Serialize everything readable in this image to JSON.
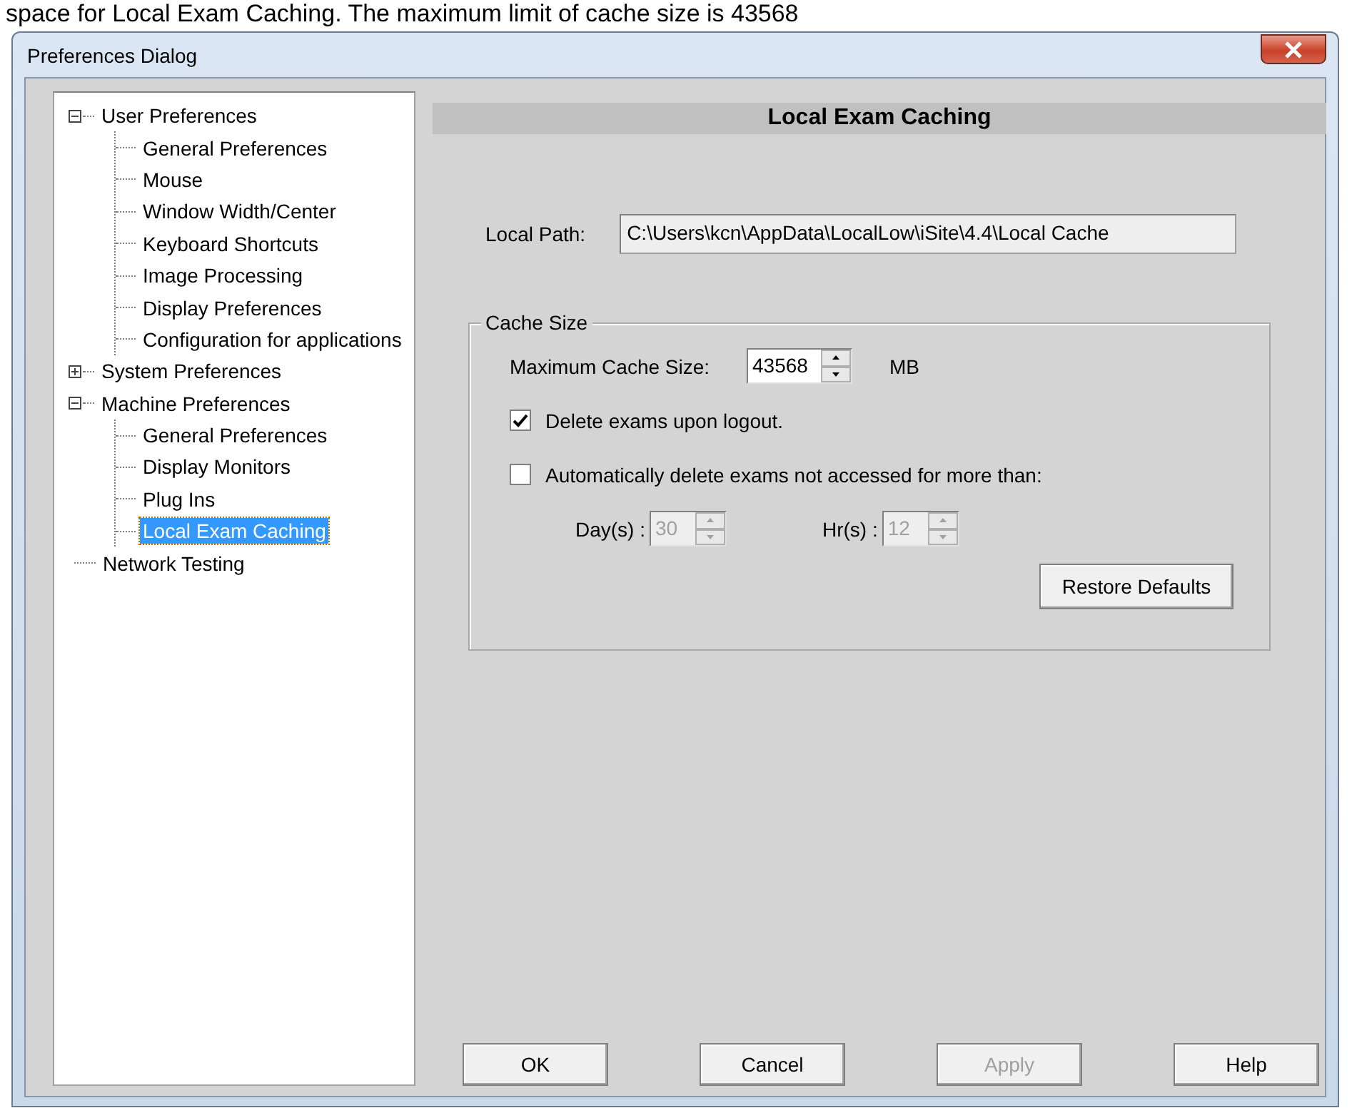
{
  "caption": "space for Local Exam Caching. The maximum limit of cache size is 43568",
  "window": {
    "title": "Preferences Dialog"
  },
  "tree": [
    {
      "label": "User Preferences",
      "expanded": true,
      "selected": false,
      "children": [
        {
          "label": "General Preferences",
          "selected": false
        },
        {
          "label": "Mouse",
          "selected": false
        },
        {
          "label": "Window Width/Center",
          "selected": false
        },
        {
          "label": "Keyboard Shortcuts",
          "selected": false
        },
        {
          "label": "Image Processing",
          "selected": false
        },
        {
          "label": "Display Preferences",
          "selected": false
        },
        {
          "label": "Configuration for applications",
          "selected": false
        }
      ]
    },
    {
      "label": "System Preferences",
      "expanded": false,
      "selected": false
    },
    {
      "label": "Machine Preferences",
      "expanded": true,
      "selected": false,
      "children": [
        {
          "label": "General Preferences",
          "selected": false
        },
        {
          "label": "Display Monitors",
          "selected": false
        },
        {
          "label": "Plug Ins",
          "selected": false
        },
        {
          "label": "Local Exam Caching",
          "selected": true
        }
      ]
    },
    {
      "label": "Network Testing",
      "selected": false
    }
  ],
  "panel": {
    "heading": "Local Exam Caching",
    "local_path": {
      "label": "Local Path:",
      "value": "C:\\Users\\kcn\\AppData\\LocalLow\\iSite\\4.4\\Local Cache"
    },
    "cache_size": {
      "title": "Cache Size",
      "max_size": {
        "label": "Maximum Cache Size:",
        "value": "43568",
        "unit": "MB",
        "disabled": false
      },
      "options": [
        {
          "label": "Delete exams upon logout.",
          "checked": true
        },
        {
          "label": "Automatically delete exams not accessed for more than:",
          "checked": false
        }
      ],
      "days": {
        "label": "Day(s) :",
        "value": "30",
        "disabled": true
      },
      "hours": {
        "label": "Hr(s) :",
        "value": "12",
        "disabled": true
      },
      "restore_button": "Restore Defaults"
    }
  },
  "buttons": [
    {
      "label": "OK",
      "disabled": false
    },
    {
      "label": "Cancel",
      "disabled": false
    },
    {
      "label": "Apply",
      "disabled": true
    },
    {
      "label": "Help",
      "disabled": false
    }
  ]
}
